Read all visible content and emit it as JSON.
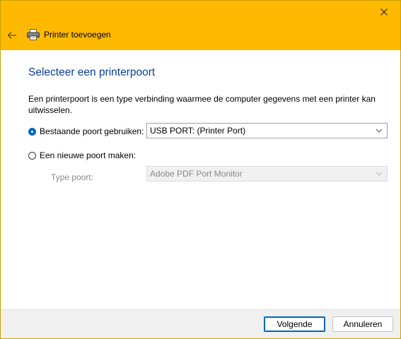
{
  "window": {
    "title": "Printer toevoegen",
    "accent_color": "#ffb900",
    "close_icon": "close-icon",
    "back_icon": "back-arrow-icon",
    "app_icon": "printer-icon"
  },
  "main": {
    "heading": "Selecteer een printerpoort",
    "description": "Een printerpoort is een type verbinding waarmee de computer gegevens met een printer kan uitwisselen.",
    "existing_port": {
      "label": "Bestaande poort gebruiken:",
      "selected": true,
      "value": "USB PORT: (Printer Port)"
    },
    "new_port": {
      "label": "Een nieuwe poort maken:",
      "selected": false,
      "type_label": "Type poort:",
      "type_value": "Adobe PDF Port Monitor"
    }
  },
  "footer": {
    "next_label": "Volgende",
    "cancel_label": "Annuleren"
  }
}
